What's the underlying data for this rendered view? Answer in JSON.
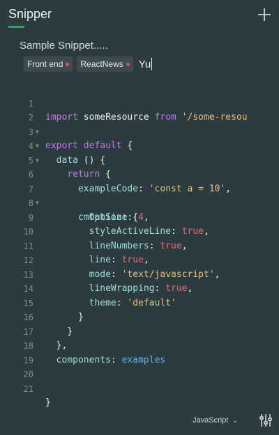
{
  "app": {
    "title": "Snipper",
    "accent": "#2fa35a",
    "background": "#2b3b40",
    "add_icon": "plus-icon"
  },
  "snippet": {
    "title": "Sample Snippet.....",
    "tags": [
      {
        "label": "Front end"
      },
      {
        "label": "ReactNews"
      }
    ],
    "tag_input_value": "Yu"
  },
  "editor": {
    "lines": [
      {
        "n": "1",
        "fold": false
      },
      {
        "n": "2",
        "fold": true
      },
      {
        "n": "3",
        "fold": true
      },
      {
        "n": "4",
        "fold": true
      },
      {
        "n": "5",
        "fold": false
      },
      {
        "n": "6",
        "fold": false
      },
      {
        "n": "7",
        "fold": true
      },
      {
        "n": "8",
        "fold": false
      },
      {
        "n": "9",
        "fold": false
      },
      {
        "n": "10",
        "fold": false
      },
      {
        "n": "11",
        "fold": false
      },
      {
        "n": "12",
        "fold": false
      },
      {
        "n": "13",
        "fold": false
      },
      {
        "n": "14",
        "fold": false
      },
      {
        "n": "15",
        "fold": false
      },
      {
        "n": "16",
        "fold": false
      },
      {
        "n": "17",
        "fold": false
      },
      {
        "n": "18",
        "fold": false
      },
      {
        "n": "19",
        "fold": false
      },
      {
        "n": "20",
        "fold": false
      },
      {
        "n": "21",
        "fold": false
      }
    ],
    "tokens": {
      "l1": [
        "import",
        " someResource ",
        "from",
        " '/some-resou"
      ],
      "l2": [
        "export",
        " ",
        "default",
        " {"
      ],
      "l3": [
        "data",
        " () {"
      ],
      "l4": [
        "return",
        " {"
      ],
      "l6": [
        "exampleCode",
        ": ",
        "'const a = 10'",
        ","
      ],
      "l7": [
        "cmOption",
        ": {"
      ],
      "l8": [
        "tabSize",
        ": ",
        "4",
        ","
      ],
      "l9": [
        "styleActiveLine",
        ": ",
        "true",
        ","
      ],
      "l10": [
        "lineNumbers",
        ": ",
        "true",
        ","
      ],
      "l11": [
        "line",
        ": ",
        "true",
        ","
      ],
      "l12": [
        "mode",
        ": ",
        "'text/javascript'",
        ","
      ],
      "l13": [
        "lineWrapping",
        ": ",
        "true",
        ","
      ],
      "l14": [
        "theme",
        ": ",
        "'default'"
      ],
      "l15": [
        "}"
      ],
      "l16": [
        "}"
      ],
      "l17": [
        "},"
      ],
      "l18": [
        "components",
        ": ",
        "examples"
      ],
      "l21": [
        "}"
      ]
    }
  },
  "footer": {
    "language": "JavaScript",
    "settings_icon": "sliders-icon"
  }
}
